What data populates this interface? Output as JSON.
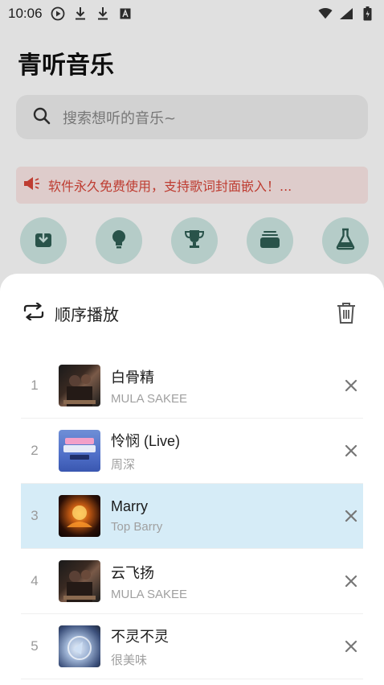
{
  "status_bar": {
    "time": "10:06"
  },
  "app": {
    "title": "青听音乐",
    "search_placeholder": "搜索想听的音乐~",
    "notice": "软件永久免费使用，支持歌词封面嵌入！...",
    "shortcut_icons": [
      "download-icon",
      "lightbulb-icon",
      "trophy-icon",
      "album-icon",
      "flask-icon"
    ],
    "accent_color": "#cfe9e4"
  },
  "playlist_sheet": {
    "mode_label": "顺序播放",
    "active_index": 3,
    "active_color": "#d6ecf7",
    "items": [
      {
        "num": "1",
        "title": "白骨精",
        "artist": "MULA SAKEE"
      },
      {
        "num": "2",
        "title": "怜悯 (Live)",
        "artist": "周深"
      },
      {
        "num": "3",
        "title": "Marry",
        "artist": "Top Barry"
      },
      {
        "num": "4",
        "title": "云飞扬",
        "artist": "MULA SAKEE"
      },
      {
        "num": "5",
        "title": "不灵不灵",
        "artist": "很美味"
      }
    ]
  }
}
